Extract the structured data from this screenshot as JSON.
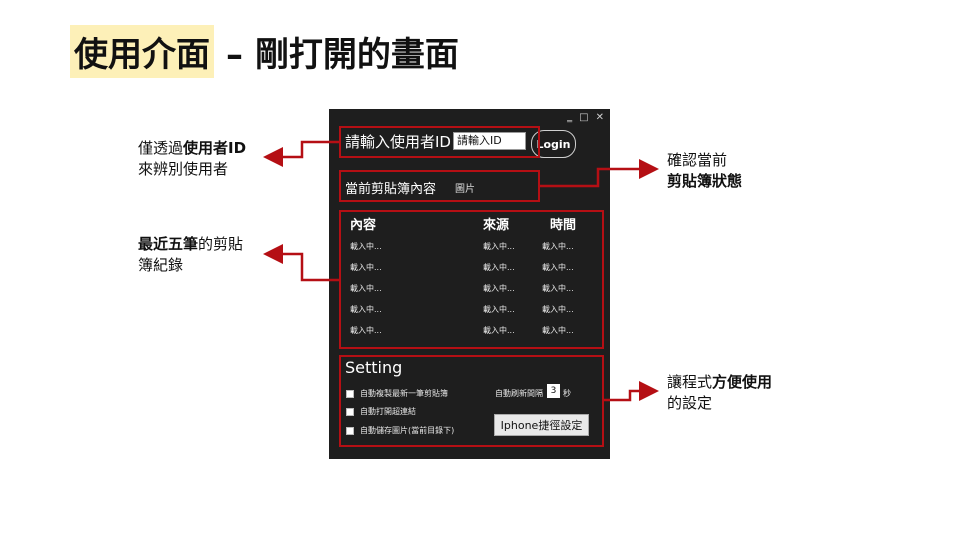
{
  "slide": {
    "title_main": "使用介面",
    "title_rest": "– 剛打開的畫面"
  },
  "callouts": {
    "id": {
      "line1_pre": "僅透過",
      "line1_bold": "使用者ID",
      "line2": "來辨別使用者"
    },
    "recent": {
      "line1_bold": "最近五筆",
      "line1_post": "的剪貼",
      "line2": "簿紀錄"
    },
    "clipboard": {
      "line1": "確認當前",
      "line2_bold": "剪貼簿狀態"
    },
    "settings": {
      "line1_pre": "讓程式",
      "line1_bold": "方便使用",
      "line2": "的設定"
    }
  },
  "app": {
    "window_buttons": [
      "‗",
      "□",
      "✕"
    ],
    "id_label": "請輸入使用者ID",
    "id_placeholder": "請輸入ID",
    "login_label": "Login",
    "clipboard_label": "當前剪貼簿內容",
    "clipboard_value": "圖片",
    "history": {
      "columns": [
        "內容",
        "來源",
        "時間"
      ],
      "rows": [
        [
          "載入中...",
          "載入中...",
          "載入中..."
        ],
        [
          "載入中...",
          "載入中...",
          "載入中..."
        ],
        [
          "載入中...",
          "載入中...",
          "載入中..."
        ],
        [
          "載入中...",
          "載入中...",
          "載入中..."
        ],
        [
          "載入中...",
          "載入中...",
          "載入中..."
        ]
      ]
    },
    "settings": {
      "title": "Setting",
      "options": [
        "自動複製最新一筆剪貼簿",
        "自動打開超連結",
        "自動儲存圖片(當前目錄下)"
      ],
      "refresh_label": "自動刷新間隔",
      "refresh_value": "3",
      "refresh_unit": "秒",
      "iphone_button": "Iphone捷徑設定"
    }
  },
  "colors": {
    "accent_red": "#b50f14",
    "title_highlight": "#fdf0b8",
    "app_bg": "#1e1e1e"
  }
}
